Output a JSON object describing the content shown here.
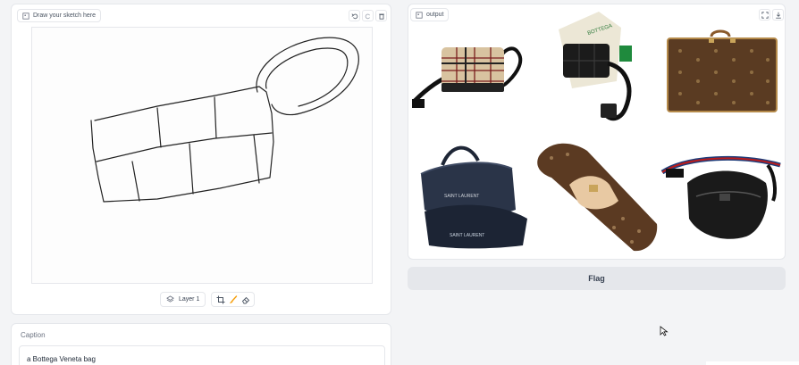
{
  "sketch": {
    "label": "Draw your sketch here",
    "icons": [
      "undo-icon",
      "redo-icon",
      "trash-icon"
    ],
    "layer_label": "Layer 1",
    "tools": [
      "crop-icon",
      "brush-icon",
      "eraser-icon"
    ]
  },
  "output": {
    "label": "output",
    "icons": [
      "fullscreen-icon",
      "download-icon"
    ],
    "images": [
      "burberry-check-camera-bag",
      "black-crossbody-bag-with-green-box",
      "brown-monogram-suitcase",
      "navy-saint-laurent-duffel-bag",
      "monogram-eyeglass-case",
      "black-belt-bag-striped-strap"
    ],
    "duffel_print": "SAINT LAURENT"
  },
  "flag": {
    "label": "Flag"
  },
  "caption": {
    "label": "Caption",
    "value": "a Bottega Veneta bag"
  },
  "colors": {
    "panel_border": "#e5e7eb",
    "button_bg": "#e5e7eb",
    "background": "#f3f4f6"
  }
}
